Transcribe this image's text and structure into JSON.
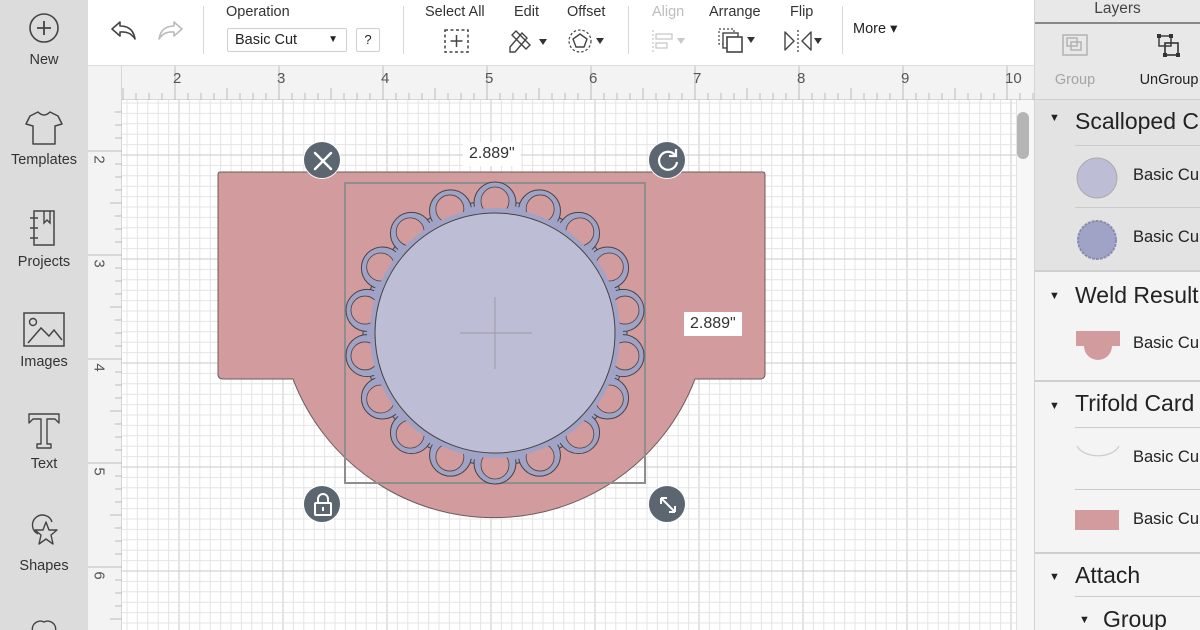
{
  "sidebar": {
    "items": [
      {
        "label": "New",
        "icon": "plus-circle-icon"
      },
      {
        "label": "Templates",
        "icon": "tshirt-icon"
      },
      {
        "label": "Projects",
        "icon": "notebook-icon"
      },
      {
        "label": "Images",
        "icon": "image-icon"
      },
      {
        "label": "Text",
        "icon": "text-icon"
      },
      {
        "label": "Shapes",
        "icon": "shapes-icon"
      }
    ]
  },
  "toolbar": {
    "undo_icon": "undo-icon",
    "redo_icon": "redo-icon",
    "operation_label": "Operation",
    "operation_value": "Basic Cut",
    "help_label": "?",
    "select_all_label": "Select All",
    "edit_label": "Edit",
    "offset_label": "Offset",
    "align_label": "Align",
    "arrange_label": "Arrange",
    "flip_label": "Flip",
    "more_label": "More ▾"
  },
  "ruler": {
    "top": [
      "2",
      "3",
      "4",
      "5",
      "6",
      "7",
      "8",
      "9",
      "10"
    ],
    "left": [
      "2",
      "3",
      "4",
      "5",
      "6"
    ]
  },
  "canvas": {
    "width_label": "2.889\"",
    "height_label": "2.889\"",
    "colors": {
      "card": "#d29b9e",
      "scallop": "#a0a3c6",
      "circle": "#bdbed6",
      "handle": "#5c6670"
    }
  },
  "layers": {
    "title": "Layers",
    "group_label": "Group",
    "ungroup_label": "UnGroup",
    "groups": [
      {
        "title": "Scalloped C",
        "items": [
          {
            "label": "Basic Cu"
          },
          {
            "label": "Basic Cu"
          }
        ]
      },
      {
        "title": "Weld Result",
        "items": [
          {
            "label": "Basic Cu"
          }
        ]
      },
      {
        "title": "Trifold Card",
        "items": [
          {
            "label": "Basic Cu"
          },
          {
            "label": "Basic Cu"
          }
        ]
      },
      {
        "title": "Attach",
        "items": []
      },
      {
        "title": "Group",
        "items": []
      }
    ]
  }
}
